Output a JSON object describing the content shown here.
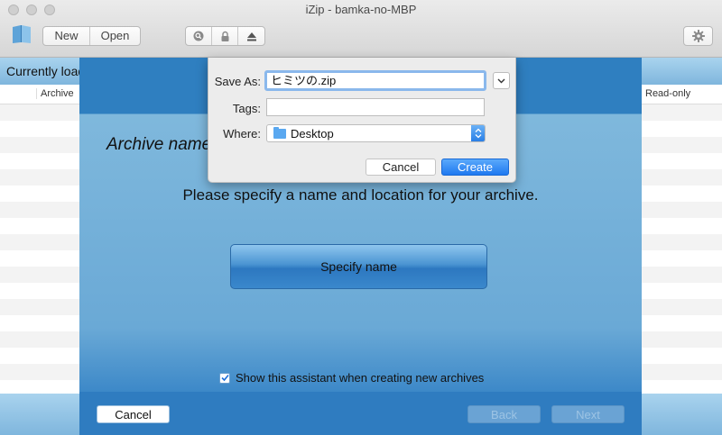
{
  "window": {
    "title": "iZip - bamka-no-MBP"
  },
  "toolbar": {
    "new_label": "New",
    "open_label": "Open",
    "icons": [
      "search-icon",
      "lock-icon",
      "eject-icon",
      "gear-icon"
    ]
  },
  "list": {
    "header_label": "Currently loaded",
    "columns": {
      "archive": "Archive",
      "readonly": "Read-only"
    }
  },
  "assistant": {
    "title": "Archive name",
    "instruction": "Please specify a name and location for your archive.",
    "specify_button": "Specify name",
    "show_assistant_label": "Show this assistant when creating new archives",
    "show_assistant_checked": true,
    "cancel_label": "Cancel",
    "back_label": "Back",
    "next_label": "Next"
  },
  "save_dialog": {
    "save_as_label": "Save As:",
    "save_as_value": "ヒミツの.zip",
    "tags_label": "Tags:",
    "tags_value": "",
    "where_label": "Where:",
    "where_value": "Desktop",
    "cancel_label": "Cancel",
    "create_label": "Create"
  },
  "colors": {
    "accent": "#1f79f0",
    "sheet_blue": "#2f7cc0"
  }
}
